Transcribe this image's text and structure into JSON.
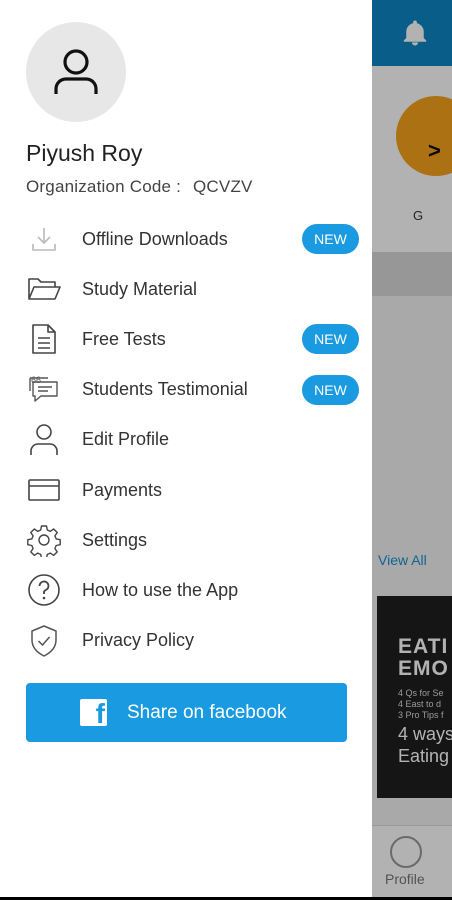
{
  "background": {
    "arrow": ">",
    "g_label": "G",
    "view_all": "View All",
    "article_title": "EATI\nEMO",
    "article_lines": [
      "4 Qs for Se",
      "4 East to d",
      "3 Pro Tips f"
    ],
    "article_bottom": "4 ways\nEating",
    "bottom_nav_label": "Profile"
  },
  "drawer": {
    "user_name": "Piyush Roy",
    "org_label": "Organization Code :",
    "org_code": "QCVZV",
    "menu": [
      {
        "label": "Offline Downloads",
        "icon": "download-icon",
        "badge": "NEW"
      },
      {
        "label": "Study Material",
        "icon": "folder-icon",
        "badge": ""
      },
      {
        "label": "Free Tests",
        "icon": "document-icon",
        "badge": "NEW"
      },
      {
        "label": "Students Testimonial",
        "icon": "chat-quote-icon",
        "badge": "NEW"
      },
      {
        "label": "Edit Profile",
        "icon": "person-icon",
        "badge": ""
      },
      {
        "label": "Payments",
        "icon": "card-icon",
        "badge": ""
      },
      {
        "label": "Settings",
        "icon": "gear-icon",
        "badge": ""
      },
      {
        "label": "How to use the App",
        "icon": "help-icon",
        "badge": ""
      },
      {
        "label": "Privacy Policy",
        "icon": "shield-icon",
        "badge": ""
      }
    ],
    "share_label": "Share on facebook"
  },
  "colors": {
    "accent": "#1a9ae0",
    "topbar": "#0c86c4"
  }
}
